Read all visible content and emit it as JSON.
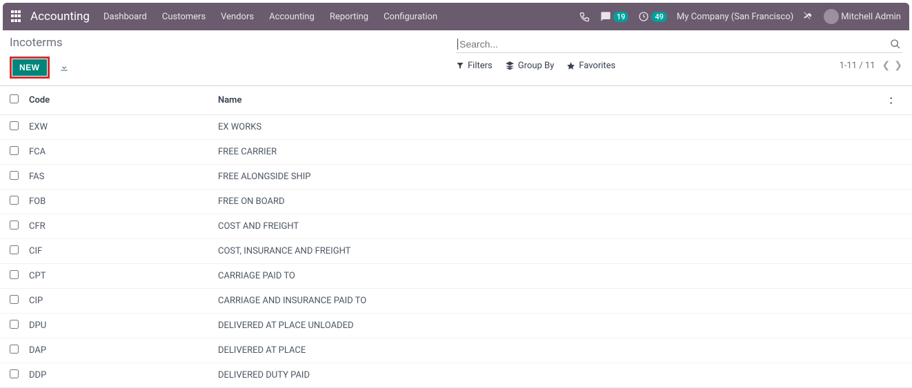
{
  "topbar": {
    "app_title": "Accounting",
    "menu": [
      "Dashboard",
      "Customers",
      "Vendors",
      "Accounting",
      "Reporting",
      "Configuration"
    ],
    "messages_badge": "19",
    "activities_badge": "49",
    "company": "My Company (San Francisco)",
    "user_name": "Mitchell Admin"
  },
  "page": {
    "title": "Incoterms",
    "new_button": "NEW"
  },
  "search": {
    "placeholder": "Search..."
  },
  "filters": {
    "filters_label": "Filters",
    "groupby_label": "Group By",
    "favorites_label": "Favorites"
  },
  "pager": {
    "text": "1-11 / 11"
  },
  "columns": {
    "code": "Code",
    "name": "Name"
  },
  "rows": [
    {
      "code": "EXW",
      "name": "EX WORKS"
    },
    {
      "code": "FCA",
      "name": "FREE CARRIER"
    },
    {
      "code": "FAS",
      "name": "FREE ALONGSIDE SHIP"
    },
    {
      "code": "FOB",
      "name": "FREE ON BOARD"
    },
    {
      "code": "CFR",
      "name": "COST AND FREIGHT"
    },
    {
      "code": "CIF",
      "name": "COST, INSURANCE AND FREIGHT"
    },
    {
      "code": "CPT",
      "name": "CARRIAGE PAID TO"
    },
    {
      "code": "CIP",
      "name": "CARRIAGE AND INSURANCE PAID TO"
    },
    {
      "code": "DPU",
      "name": "DELIVERED AT PLACE UNLOADED"
    },
    {
      "code": "DAP",
      "name": "DELIVERED AT PLACE"
    },
    {
      "code": "DDP",
      "name": "DELIVERED DUTY PAID"
    }
  ]
}
